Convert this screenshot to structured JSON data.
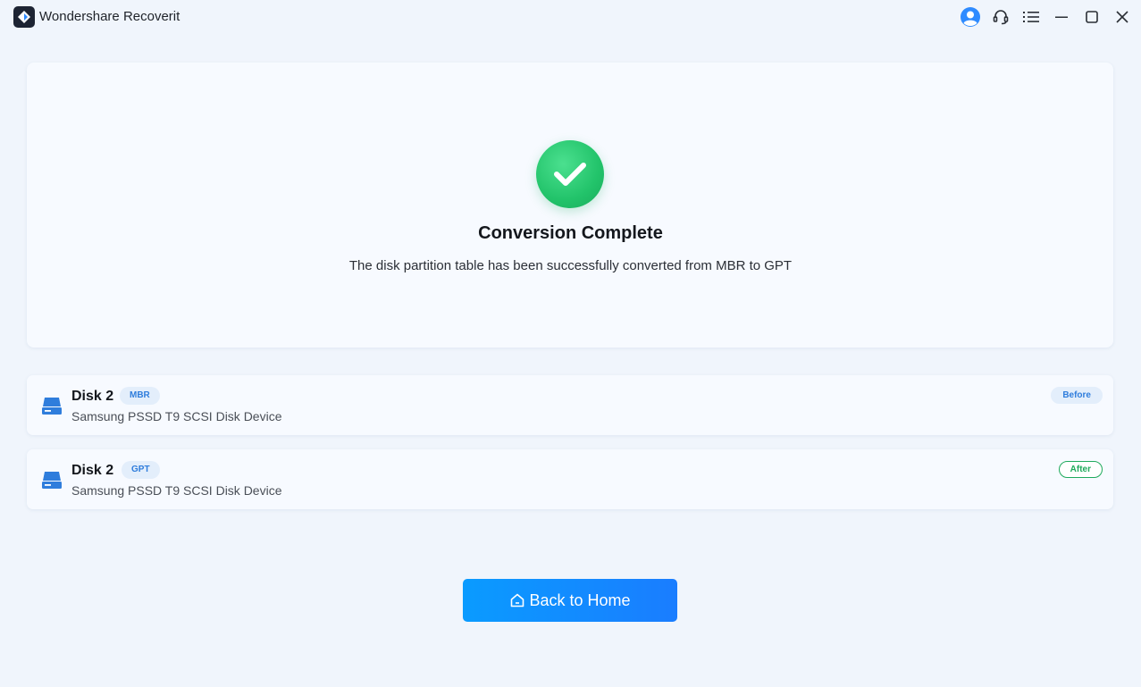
{
  "app": {
    "title": "Wondershare Recoverit"
  },
  "titlebar": {
    "icons": [
      "user-avatar-icon",
      "headset-support-icon",
      "menu-icon",
      "minimize-icon",
      "maximize-icon",
      "close-icon"
    ]
  },
  "result": {
    "icon": "check-icon",
    "headline": "Conversion Complete",
    "message": "The disk partition table has been successfully converted from MBR to GPT"
  },
  "disks": [
    {
      "name": "Disk 2",
      "partition": "MBR",
      "description": "Samsung PSSD T9 SCSI Disk Device",
      "state": "Before"
    },
    {
      "name": "Disk 2",
      "partition": "GPT",
      "description": "Samsung PSSD T9 SCSI Disk Device",
      "state": "After"
    }
  ],
  "actions": {
    "back_home_label": "Back to Home",
    "back_home_icon": "home-icon"
  },
  "colors": {
    "accent": "#1a7dff",
    "success": "#22c36a",
    "badge_blue": "#2f7ddc",
    "badge_green": "#1faa5c",
    "background": "#f0f5fc"
  }
}
